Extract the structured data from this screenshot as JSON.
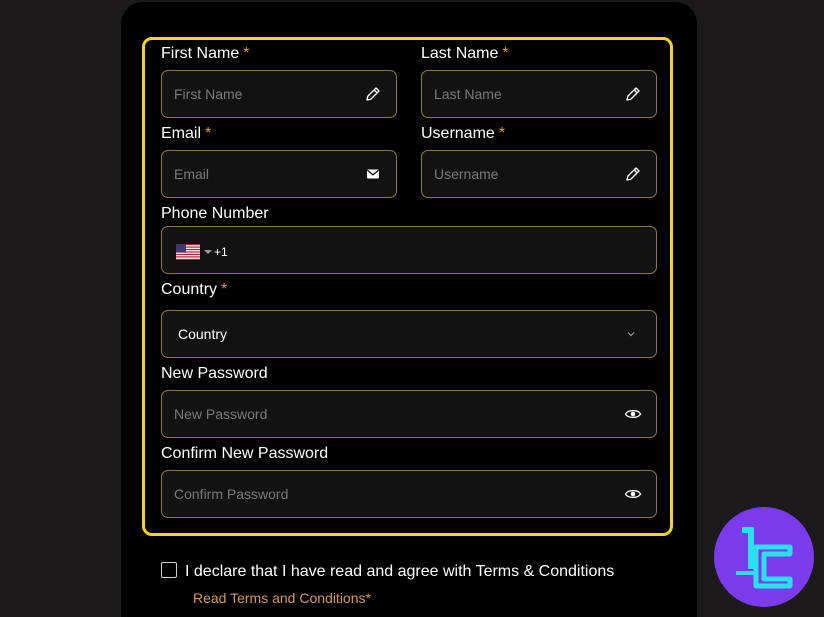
{
  "form": {
    "first_name": {
      "label": "First Name",
      "required_mark": "*",
      "placeholder": "First Name",
      "icon": "pencil-icon"
    },
    "last_name": {
      "label": "Last Name",
      "required_mark": "*",
      "placeholder": "Last Name",
      "icon": "pencil-icon"
    },
    "email": {
      "label": "Email",
      "required_mark": "*",
      "placeholder": "Email",
      "icon": "envelope-icon"
    },
    "username": {
      "label": "Username",
      "required_mark": "*",
      "placeholder": "Username",
      "icon": "pencil-icon"
    },
    "phone": {
      "label": "Phone Number",
      "country_flag": "us-flag-icon",
      "dial_code": "+1"
    },
    "country": {
      "label": "Country",
      "required_mark": "*",
      "selected": "Country",
      "icon": "chevron-down-icon"
    },
    "new_password": {
      "label": "New Password",
      "placeholder": "New Password",
      "icon": "eye-icon"
    },
    "confirm_password": {
      "label": "Confirm New Password",
      "placeholder": "Confirm Password",
      "icon": "eye-icon"
    },
    "agreement": {
      "text": "I declare that I have read and agree with Terms & Conditions",
      "link": "Read Terms and Conditions*"
    }
  },
  "colors": {
    "background": "#1c1a1a",
    "panel": "#000000",
    "highlight_border": "#f5d32a",
    "field_border": "#8a7a4a",
    "accent": "#d99a5b",
    "logo_bg": "#7a3bea",
    "logo_fg": "#2de0f0"
  }
}
